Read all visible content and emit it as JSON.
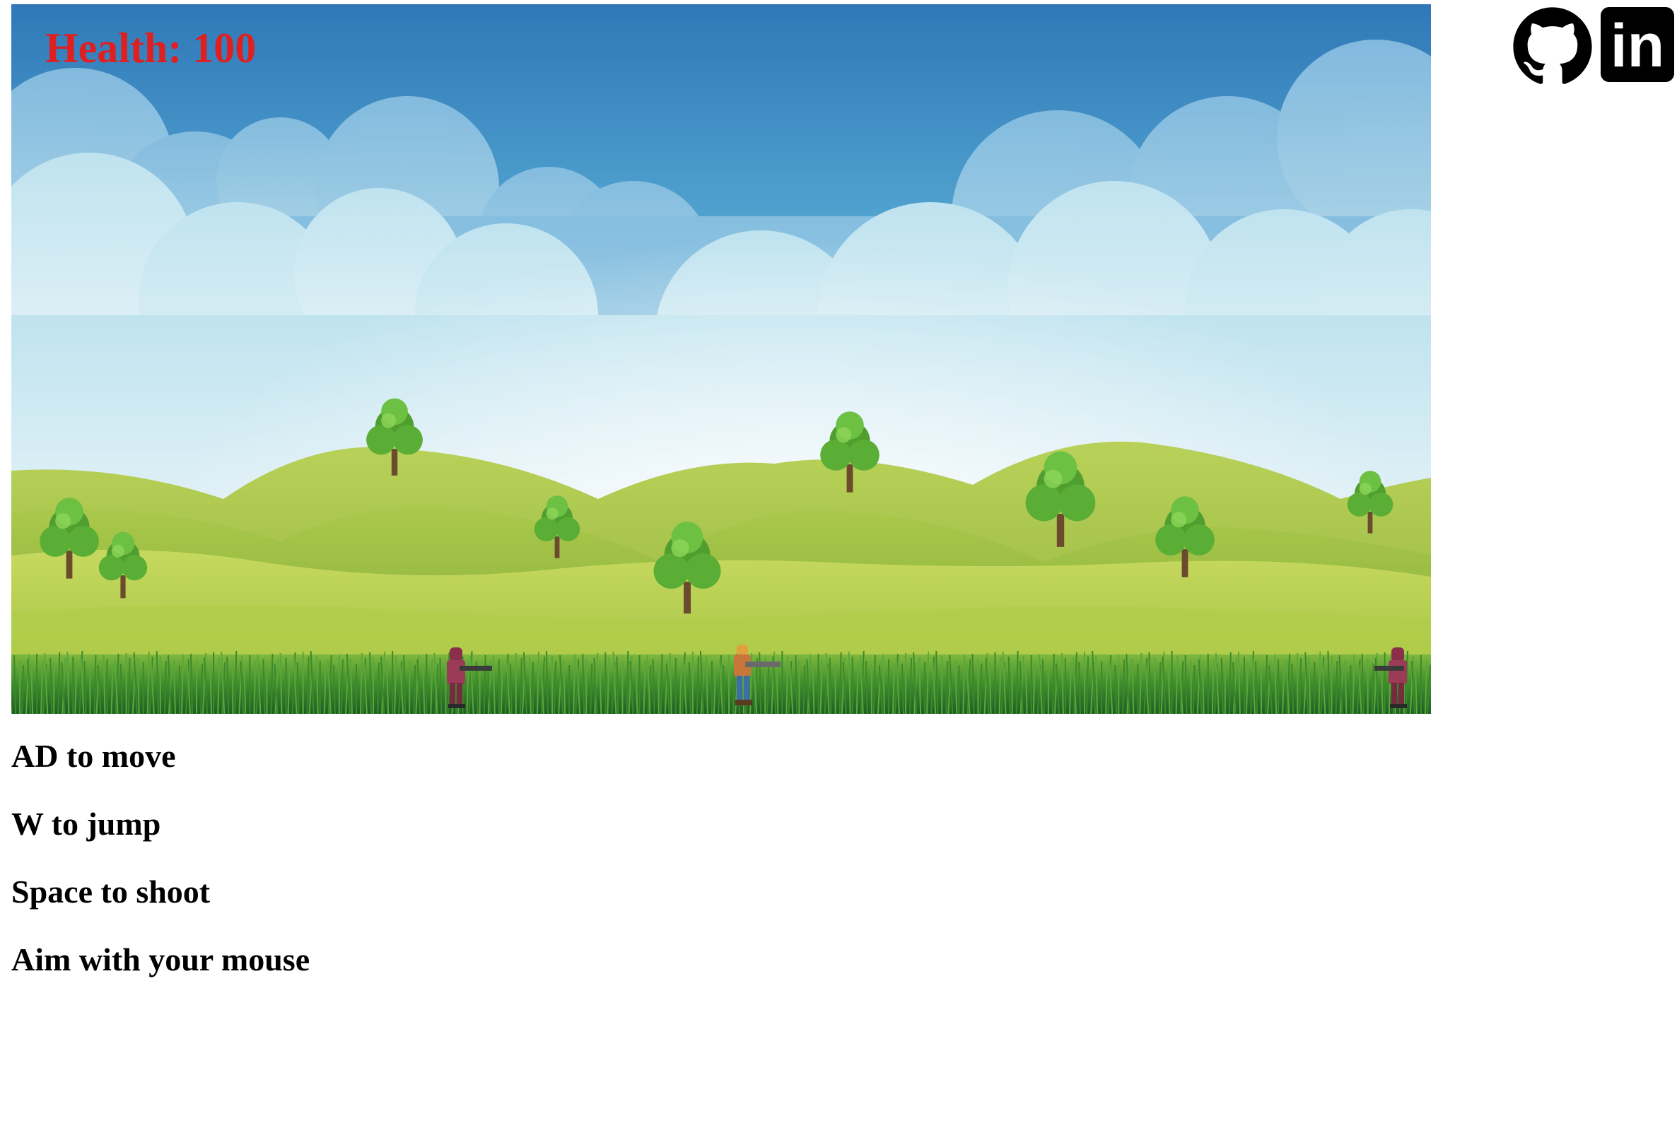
{
  "hud": {
    "health_label": "Health: 100",
    "health_value": 100,
    "health_color": "#e02020"
  },
  "scene": {
    "sky_top_color": "#2f78b8",
    "sky_mid_color": "#7cc4e0",
    "sky_horizon_color": "#e8f4f8",
    "grass_color": "#3e8f2c",
    "hill_color": "#a8c94a"
  },
  "characters": {
    "player": {
      "icon": "player-soldier-sprite",
      "facing": "right"
    },
    "enemies": [
      {
        "icon": "enemy-soldier-sprite",
        "facing": "right"
      },
      {
        "icon": "enemy-soldier-sprite",
        "facing": "left"
      }
    ]
  },
  "social": {
    "github_icon": "github-icon",
    "linkedin_icon": "linkedin-icon",
    "linkedin_text": "in"
  },
  "instructions": [
    "AD to move",
    "W to jump",
    "Space to shoot",
    "Aim with your mouse"
  ]
}
